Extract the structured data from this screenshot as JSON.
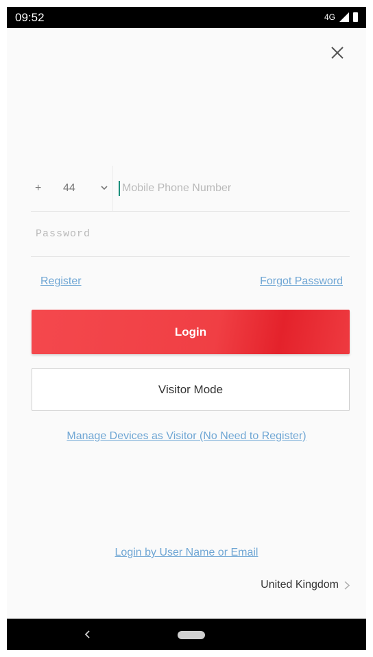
{
  "status_bar": {
    "time": "09:52",
    "network": "4G",
    "icons": [
      "signal-icon",
      "battery-icon"
    ]
  },
  "header": {
    "close_icon": "close-icon"
  },
  "phone": {
    "plus": "+",
    "country_code": "44",
    "dropdown_icon": "chevron-down-icon",
    "placeholder": "Mobile Phone Number",
    "value": ""
  },
  "password": {
    "placeholder": "Password",
    "value": ""
  },
  "links": {
    "register": "Register",
    "forgot_password": "Forgot Password",
    "manage_visitor": "Manage Devices as Visitor (No Need to Register)",
    "login_by_username": "Login by User Name or Email"
  },
  "buttons": {
    "login": "Login",
    "visitor_mode": "Visitor Mode"
  },
  "region": {
    "label": "United Kingdom",
    "icon": "chevron-right-icon"
  },
  "nav_bar": {
    "icons": [
      "back-icon",
      "home-icon"
    ]
  },
  "colors": {
    "accent_red": "#f03f44",
    "link_blue": "#6fa6d4",
    "cursor_teal": "#1b8f7c",
    "background": "#fafafa"
  }
}
